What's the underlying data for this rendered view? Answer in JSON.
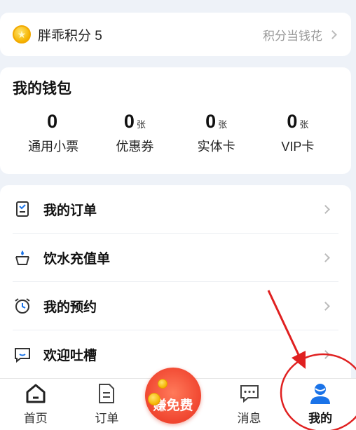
{
  "points": {
    "label": "胖乖积分 5",
    "link": "积分当钱花"
  },
  "wallet": {
    "title": "我的钱包",
    "items": [
      {
        "value": "0",
        "unit": "",
        "label": "通用小票"
      },
      {
        "value": "0",
        "unit": "张",
        "label": "优惠券"
      },
      {
        "value": "0",
        "unit": "张",
        "label": "实体卡"
      },
      {
        "value": "0",
        "unit": "张",
        "label": "VIP卡"
      }
    ]
  },
  "menu": {
    "items": [
      {
        "label": "我的订单",
        "icon": "order-list-icon"
      },
      {
        "label": "饮水充值单",
        "icon": "water-cup-icon"
      },
      {
        "label": "我的预约",
        "icon": "alarm-clock-icon"
      },
      {
        "label": "欢迎吐槽",
        "icon": "feedback-chat-icon"
      }
    ]
  },
  "bottom_nav": {
    "items": [
      {
        "label": "首页",
        "icon": "home-icon"
      },
      {
        "label": "订单",
        "icon": "order-icon"
      },
      {
        "label": "",
        "icon": "earn-free-icon"
      },
      {
        "label": "消息",
        "icon": "message-icon"
      },
      {
        "label": "我的",
        "icon": "profile-icon",
        "active": true
      }
    ],
    "earn_label": "赚免费"
  },
  "colors": {
    "accent": "#1a73e8",
    "annotation_red": "#e02020",
    "earn_red": "#f0452f"
  }
}
